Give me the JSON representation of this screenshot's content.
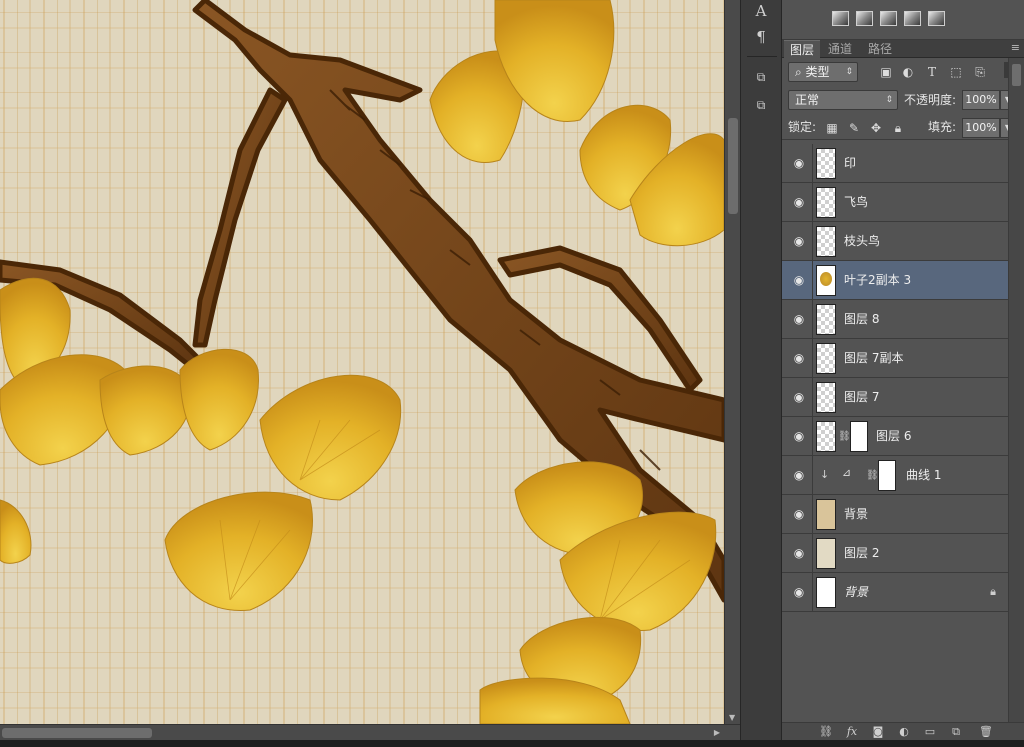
{
  "layers_panel": {
    "tabs": [
      {
        "label": "图层",
        "active": true
      },
      {
        "label": "通道",
        "active": false
      },
      {
        "label": "路径",
        "active": false
      }
    ],
    "filter_kind": "类型",
    "blend_mode": "正常",
    "opacity_label": "不透明度:",
    "opacity_value": "100%",
    "lock_label": "锁定:",
    "fill_label": "填充:",
    "fill_value": "100%",
    "layers": [
      {
        "name": "印",
        "visible": true,
        "selected": false
      },
      {
        "name": "飞鸟",
        "visible": true,
        "selected": false
      },
      {
        "name": "枝头鸟",
        "visible": true,
        "selected": false
      },
      {
        "name": "叶子2副本 3",
        "visible": true,
        "selected": true
      },
      {
        "name": "图层 8",
        "visible": true,
        "selected": false
      },
      {
        "name": "图层 7副本",
        "visible": true,
        "selected": false
      },
      {
        "name": "图层 7",
        "visible": true,
        "selected": false
      },
      {
        "name": "图层 6",
        "visible": true,
        "selected": false,
        "has_mask": true
      },
      {
        "name": "曲线 1",
        "visible": true,
        "selected": false,
        "adjustment": "curves",
        "clipped": true
      },
      {
        "name": "背景",
        "visible": true,
        "selected": false
      },
      {
        "name": "图层 2",
        "visible": true,
        "selected": false
      },
      {
        "name": "背景",
        "visible": true,
        "selected": false,
        "locked": true
      }
    ]
  },
  "icons": {
    "eye": "eye-icon",
    "link": "link-icon",
    "lock": "lock-icon",
    "menu": "panel-menu-icon"
  },
  "colors": {
    "panel_bg": "#535353",
    "selected_layer": "#58677d",
    "canvas_bg": "#ddd3ba",
    "branch": "#6b3f14",
    "leaf": "#e6b62a"
  }
}
